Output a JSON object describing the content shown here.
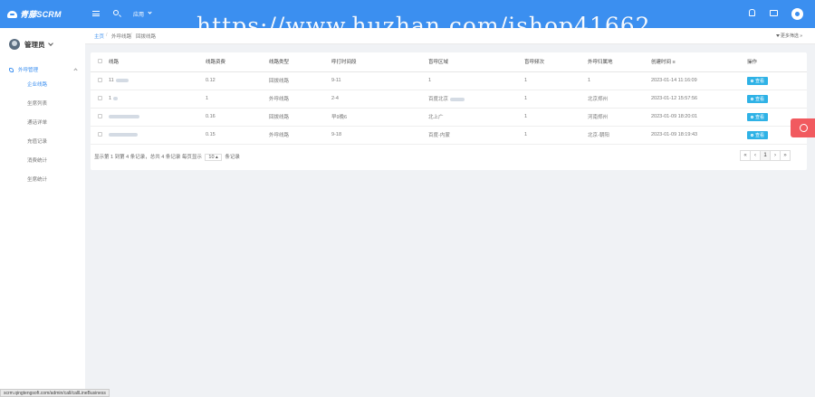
{
  "app": {
    "logo_text": "青藤SCRM"
  },
  "topbar": {
    "app_label": "应用"
  },
  "watermark": "https://www.huzhan.com/ishop41662",
  "sidebar": {
    "user": "管理员",
    "group": "外呼管理",
    "items": [
      {
        "label": "企业线路",
        "active": true
      },
      {
        "label": "坐席列表",
        "active": false
      },
      {
        "label": "通话详单",
        "active": false
      },
      {
        "label": "充值记录",
        "active": false
      },
      {
        "label": "消费统计",
        "active": false
      },
      {
        "label": "坐席统计",
        "active": false
      }
    ]
  },
  "breadcrumb": {
    "home": "主页",
    "level1": "外呼线路",
    "level2": "回拨线路"
  },
  "toolbar": {
    "more_filter": "更多筛选"
  },
  "table": {
    "headers": [
      "线路",
      "线路资费",
      "线路类型",
      "呼打时间段",
      "盲呼区域",
      "盲呼频次",
      "外呼归属地",
      "创建时间",
      "操作"
    ],
    "action_label": "查看",
    "rows": [
      {
        "line": "11",
        "fee": "0.12",
        "type": "回拨线路",
        "period": "9-11",
        "region": "1",
        "freq": "1",
        "origin": "1",
        "created": "2023-01-14 11:16:09"
      },
      {
        "line": "1",
        "fee": "1",
        "type": "外呼线路",
        "period": "2-4",
        "region": "百度北京",
        "freq": "1",
        "origin": "北京郑州",
        "created": "2023-01-12 15:57:56"
      },
      {
        "line": "",
        "fee": "0.16",
        "type": "回拨线路",
        "period": "早9晚6",
        "region": "北上广",
        "freq": "1",
        "origin": "河南郑州",
        "created": "2023-01-09 18:20:01"
      },
      {
        "line": "",
        "fee": "0.15",
        "type": "外呼线路",
        "period": "9-18",
        "region": "百度-内蒙",
        "freq": "1",
        "origin": "北京-朝阳",
        "created": "2023-01-09 18:19:43"
      }
    ]
  },
  "pagination": {
    "info_prefix": "显示第 1 到第 4 条记录，总共 4 条记录 每页显示",
    "page_size": "10",
    "info_suffix": "条记录",
    "buttons": [
      "«",
      "‹",
      "1",
      "›",
      "»"
    ]
  },
  "statusbar": "scrm.qingtengsoft.com/admin/call/callLineBusiness"
}
